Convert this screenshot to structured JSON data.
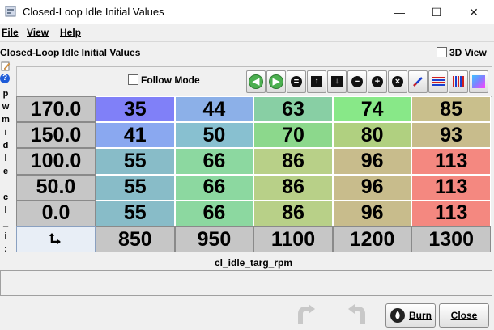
{
  "window": {
    "title": "Closed-Loop Idle Initial Values",
    "controls": [
      "—",
      "☐",
      "✕"
    ]
  },
  "menu": [
    {
      "label": "File"
    },
    {
      "label": "View"
    },
    {
      "label": "Help"
    }
  ],
  "panel": {
    "title": "Closed-Loop Idle Initial Values",
    "view3d_label": "3D View",
    "follow_mode_label": "Follow Mode",
    "y_axis_name_chars": [
      "p",
      "w",
      "m",
      "i",
      "d",
      "l",
      "e",
      "_",
      "c",
      "l",
      "_",
      "i",
      ":"
    ],
    "x_axis_name": "cl_idle_targ_rpm",
    "y_values": [
      "170.0",
      "150.0",
      "100.0",
      "50.0",
      "0.0"
    ],
    "x_values": [
      "850",
      "950",
      "1100",
      "1200",
      "1300"
    ],
    "table": [
      [
        "35",
        "44",
        "63",
        "74",
        "85"
      ],
      [
        "41",
        "50",
        "70",
        "80",
        "93"
      ],
      [
        "55",
        "66",
        "86",
        "96",
        "113"
      ],
      [
        "55",
        "66",
        "86",
        "96",
        "113"
      ],
      [
        "55",
        "66",
        "86",
        "96",
        "113"
      ]
    ],
    "cell_colors": [
      [
        "#8080f8",
        "#8cb0e8",
        "#88cfa4",
        "#88e888",
        "#c9bf8c"
      ],
      [
        "#8aa8f0",
        "#88c0d0",
        "#8cd88c",
        "#b0d080",
        "#c8bc8c"
      ],
      [
        "#88bcc8",
        "#8cd8a0",
        "#b8d088",
        "#c8bc8c",
        "#f48880"
      ],
      [
        "#88bcc8",
        "#8cd8a0",
        "#b8d088",
        "#c8bc8c",
        "#f48880"
      ],
      [
        "#88bcc8",
        "#8cd8a0",
        "#b8d088",
        "#c8bc8c",
        "#f48880"
      ]
    ]
  },
  "toolbar": {
    "buttons": [
      {
        "name": "arrow-left-icon",
        "glyph": "◀"
      },
      {
        "name": "arrow-right-icon",
        "glyph": "▶"
      },
      {
        "name": "minus-set-icon",
        "glyph": "="
      },
      {
        "name": "up-arrow-icon",
        "glyph": "↑"
      },
      {
        "name": "down-arrow-icon",
        "glyph": "↓"
      },
      {
        "name": "decrement-icon",
        "glyph": "−"
      },
      {
        "name": "increment-icon",
        "glyph": "+"
      },
      {
        "name": "multiply-icon",
        "glyph": "×"
      },
      {
        "name": "interpolate-icon",
        "glyph": ""
      },
      {
        "name": "horizontal-bars-icon",
        "glyph": ""
      },
      {
        "name": "vertical-bars-icon",
        "glyph": ""
      },
      {
        "name": "color-gradient-icon",
        "glyph": ""
      }
    ]
  },
  "footer": {
    "burn_label": "Burn",
    "close_label": "Close"
  }
}
